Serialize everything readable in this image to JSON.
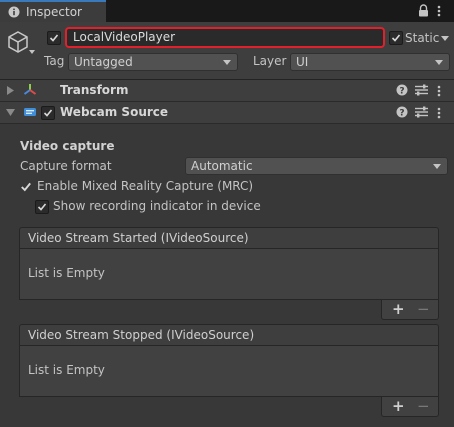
{
  "tab": {
    "label": "Inspector",
    "icon": "info-icon"
  },
  "header": {
    "name": "LocalVideoPlayer",
    "active": true,
    "static_label": "Static",
    "static": true,
    "tag_label": "Tag",
    "tag_value": "Untagged",
    "layer_label": "Layer",
    "layer_value": "UI"
  },
  "components": [
    {
      "title": "Transform",
      "icon": "transform-axes-icon",
      "expanded": false
    },
    {
      "title": "Webcam Source",
      "icon": "webcam-icon",
      "expanded": true,
      "enabled": true
    }
  ],
  "webcam": {
    "section_title": "Video capture",
    "capture_format_label": "Capture format",
    "capture_format_value": "Automatic",
    "mrc_label": "Enable Mixed Reality Capture (MRC)",
    "mrc_checked": true,
    "rec_indicator_label": "Show recording indicator in device",
    "rec_indicator_checked": true
  },
  "events": [
    {
      "title": "Video Stream Started (IVideoSource)",
      "empty_text": "List is Empty",
      "add": "+",
      "remove": "−"
    },
    {
      "title": "Video Stream Stopped (IVideoSource)",
      "empty_text": "List is Empty",
      "add": "+",
      "remove": "−"
    }
  ],
  "colors": {
    "background": "#383838",
    "highlight_border": "#e0202a",
    "tab_accent": "#3a79bb"
  }
}
